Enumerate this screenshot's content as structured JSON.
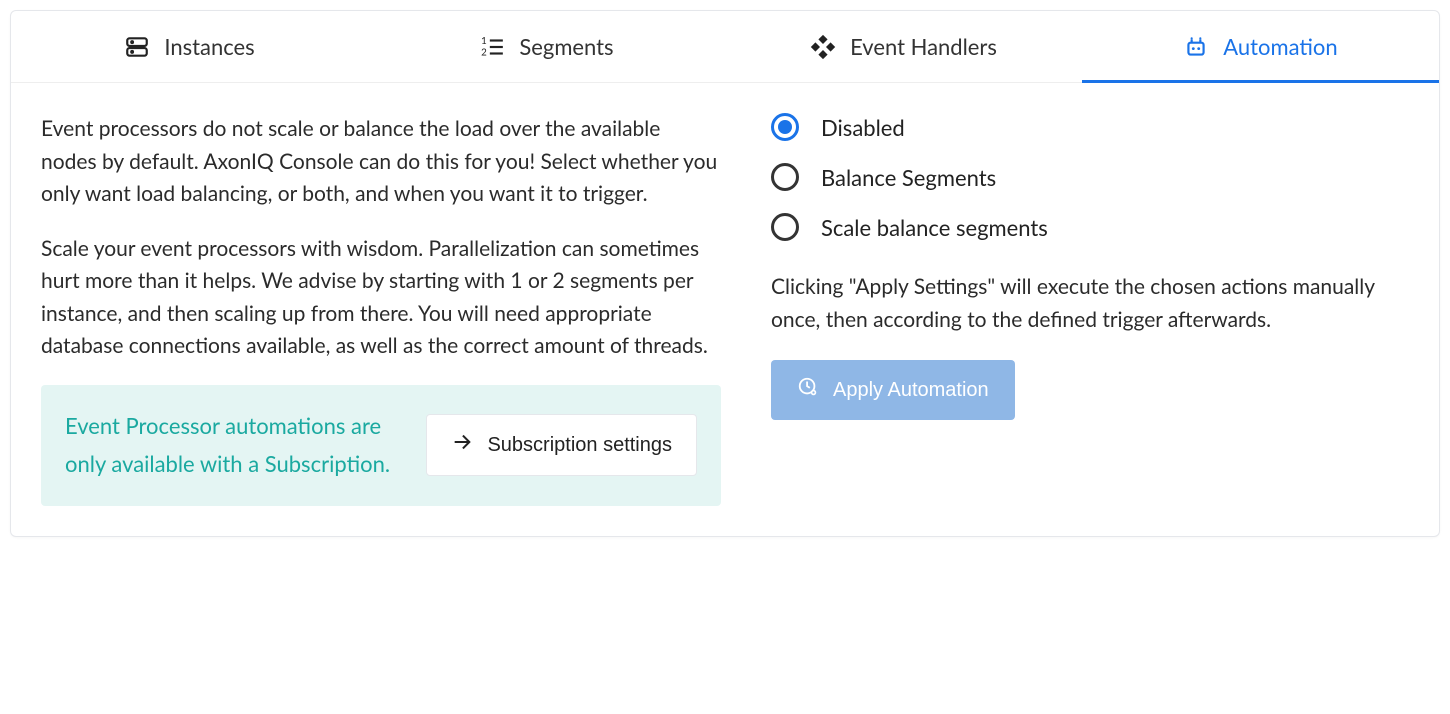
{
  "tabs": [
    {
      "label": "Instances",
      "icon": "server-icon"
    },
    {
      "label": "Segments",
      "icon": "list-icon"
    },
    {
      "label": "Event Handlers",
      "icon": "components-icon"
    },
    {
      "label": "Automation",
      "icon": "robot-icon"
    }
  ],
  "active_tab_index": 3,
  "description": {
    "p1": "Event processors do not scale or balance the load over the available nodes by default. AxonIQ Console can do this for you! Select whether you only want load balancing, or both, and when you want it to trigger.",
    "p2": "Scale your event processors with wisdom. Parallelization can sometimes hurt more than it helps. We advise by starting with 1 or 2 segments per instance, and then scaling up from there. You will need appropriate database connections available, as well as the correct amount of threads."
  },
  "info": {
    "text": "Event Processor automations are only available with a Subscription.",
    "button_label": "Subscription settings"
  },
  "automation": {
    "options": [
      {
        "label": "Disabled",
        "selected": true
      },
      {
        "label": "Balance Segments",
        "selected": false
      },
      {
        "label": "Scale balance segments",
        "selected": false
      }
    ],
    "note": "Clicking \"Apply Settings\" will execute the chosen actions manually once, then according to the defined trigger afterwards.",
    "apply_label": "Apply Automation"
  },
  "colors": {
    "accent": "#1a73e8",
    "teal": "#1aa9a0",
    "teal_bg": "#e4f5f3",
    "apply_bg": "#8fb7e6"
  }
}
